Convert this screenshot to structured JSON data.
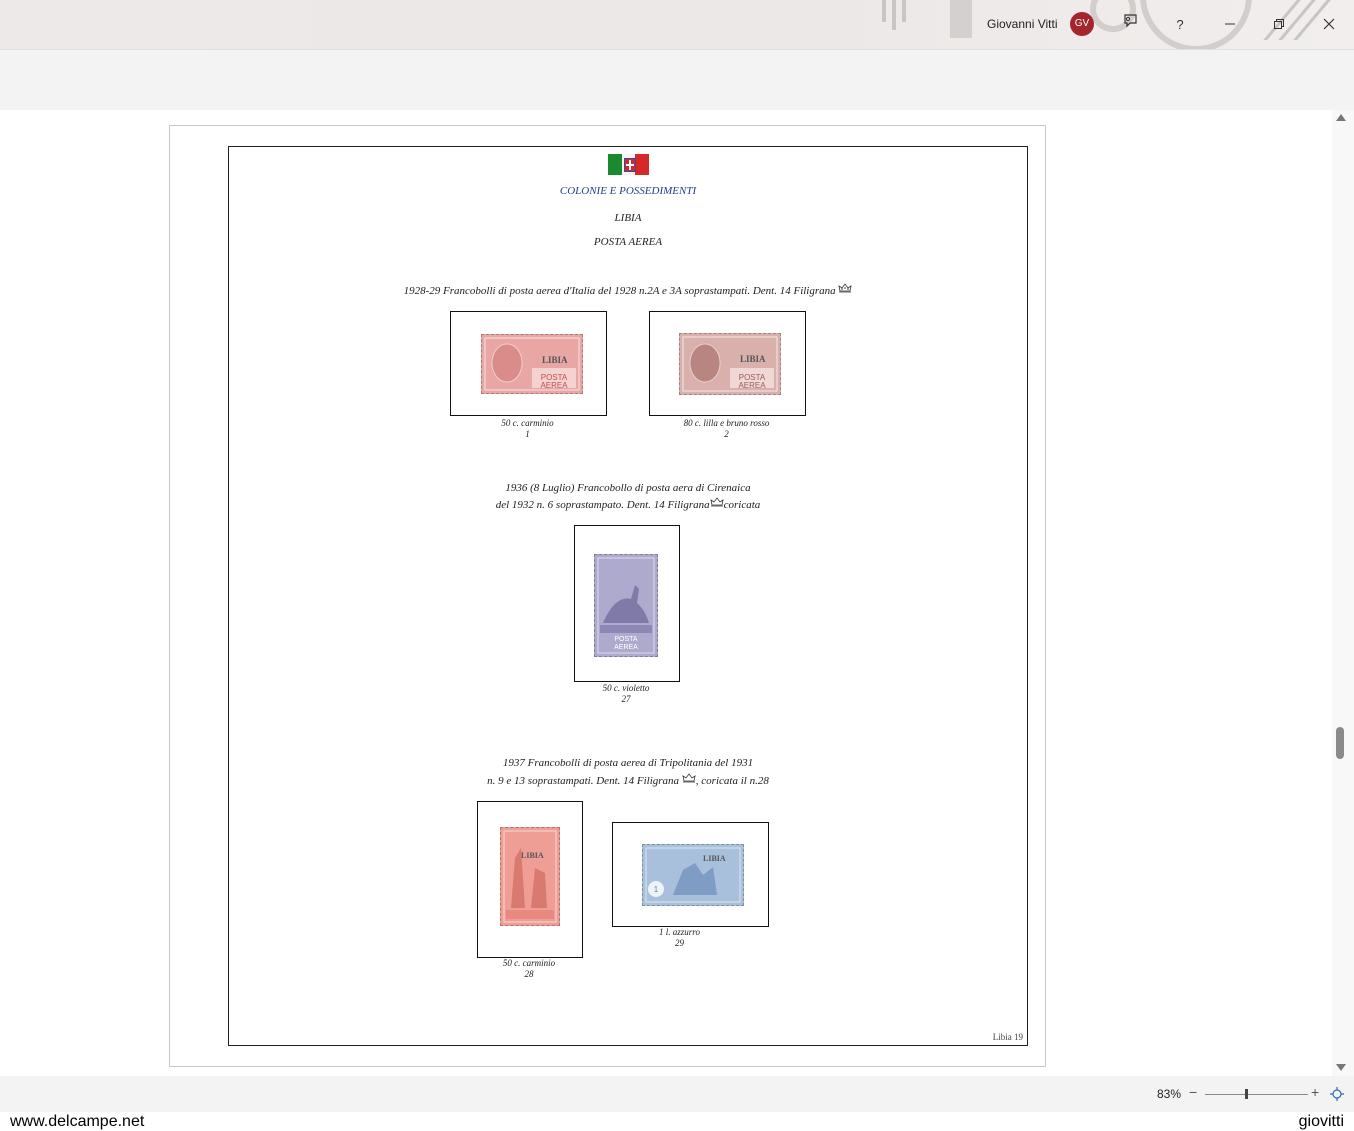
{
  "titlebar": {
    "user_name": "Giovanni Vitti",
    "avatar_initials": "GV",
    "avatar_color": "#a4262c",
    "buttons": [
      "feedback-icon",
      "help-icon",
      "minimize-icon",
      "restore-icon",
      "close-icon"
    ],
    "help_glyph": "?"
  },
  "document": {
    "heading1": "COLONIE E POSSEDIMENTI",
    "heading1_color": "#1f3d8a",
    "heading2": "LIBIA",
    "heading3": "POSTA AEREA",
    "section1": {
      "title": "1928-29 Francobolli di posta aerea d'Italia del 1928 n.2A e 3A soprastampati. Dent. 14 Filigrana",
      "stamps": [
        {
          "caption": "50 c. carminio",
          "number": "1",
          "overprint": "LIBIA",
          "label": "POSTA AEREA",
          "color": "#e8a6a4"
        },
        {
          "caption": "80 c. lilla e bruno rosso",
          "number": "2",
          "overprint": "LIBIA",
          "label": "POSTA AEREA",
          "color": "#d9b0ac"
        }
      ]
    },
    "section2": {
      "title_line1": "1936 (8 Luglio) Francobollo di posta aera di Cirenaica",
      "title_line2a": "del 1932 n. 6 soprastampato. Dent. 14 Filigrana",
      "title_line2b": "coricata",
      "stamps": [
        {
          "caption": "50 c. violetto",
          "number": "27",
          "label": "POSTA AEREA",
          "color": "#aeaacd"
        }
      ]
    },
    "section3": {
      "title_line1": "1937 Francobolli di posta aerea di Tripolitania del 1931",
      "title_line2a": "n. 9 e 13 soprastampati. Dent. 14 Filigrana",
      "title_line2b": ", coricata il n.28",
      "stamps": [
        {
          "caption": "50 c. carminio",
          "number": "28",
          "overprint": "LIBIA",
          "color": "#ee9e94"
        },
        {
          "caption": "1 l. azzurro",
          "number": "29",
          "overprint": "LIBIA",
          "color": "#a9c0dc"
        }
      ]
    },
    "page_number": "Libia 19"
  },
  "statusbar": {
    "zoom": "83%",
    "zoom_minus": "−",
    "zoom_plus": "+"
  },
  "footer": {
    "left": "www.delcampe.net",
    "right": "giovitti"
  }
}
